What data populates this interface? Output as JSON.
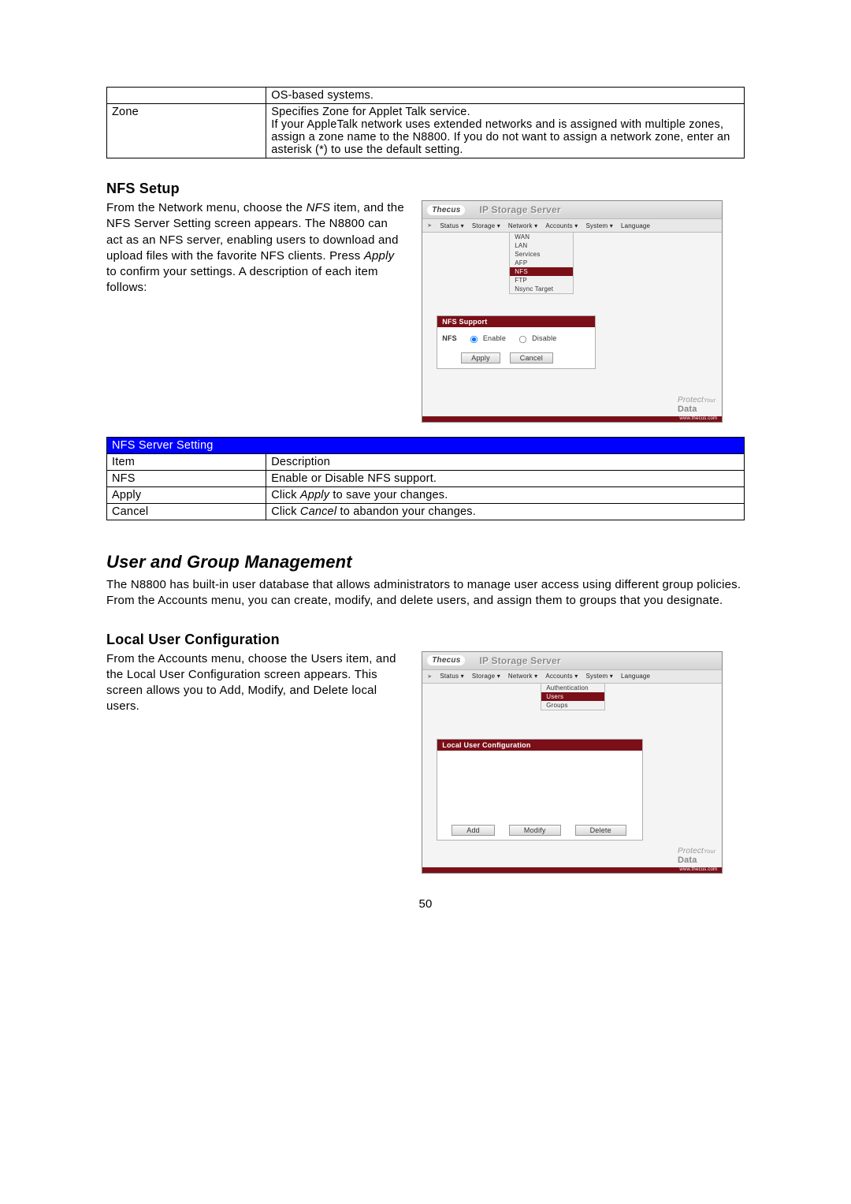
{
  "table1": {
    "r0c1": "OS-based systems.",
    "r1c0": "Zone",
    "r1c1": "Specifies Zone for Applet Talk service.\nIf your AppleTalk network uses extended networks and is assigned with multiple zones, assign a zone name to the N8800. If you do not want to assign a network zone, enter an asterisk (*) to use the default setting."
  },
  "nfs_heading": "NFS Setup",
  "nfs_para_parts": {
    "a": "From the Network menu, choose the ",
    "b": "NFS",
    "c": " item, and the NFS Server Setting screen appears. The N8800 can act as an NFS server, enabling users to download and upload files with the favorite NFS clients. Press ",
    "d": "Apply",
    "e": " to confirm your settings. A description of each item follows:"
  },
  "shot1": {
    "logo": "Thecus",
    "title": "IP Storage Server",
    "menu": [
      "Status ▾",
      "Storage ▾",
      "Network ▾",
      "Accounts ▾",
      "System ▾",
      "Language"
    ],
    "submenu": [
      "WAN",
      "LAN",
      "Services",
      "AFP",
      "NFS",
      "FTP",
      "Nsync Target"
    ],
    "submenu_selected": "NFS",
    "panel_title": "NFS Support",
    "row_label": "NFS",
    "opt_enable": "Enable",
    "opt_disable": "Disable",
    "btn_apply": "Apply",
    "btn_cancel": "Cancel",
    "protect_a": "Protect",
    "protect_b": "Your",
    "protect_c": "Data",
    "url": "www.thecus.com"
  },
  "table2": {
    "header": "NFS Server Setting",
    "r0c0": "Item",
    "r0c1": "Description",
    "r1c0": "NFS",
    "r1c1": "Enable or Disable NFS support.",
    "r2c0": "Apply",
    "r2c1a": "Click ",
    "r2c1b": "Apply",
    "r2c1c": " to save your changes.",
    "r3c0": "Cancel",
    "r3c1a": "Click ",
    "r3c1b": "Cancel",
    "r3c1c": " to abandon your changes."
  },
  "ugm_heading": "User and Group Management",
  "ugm_para": "The N8800 has built-in user database that allows administrators to manage user access using different group policies. From the Accounts menu, you can create, modify, and delete users, and assign them to groups that you designate.",
  "luc_heading": "Local User Configuration",
  "luc_para_parts": {
    "a": "From the Accounts menu, choose the Users item, and the Local User Configuration screen appears. This screen allows you to Add, Modify, and Delete local users."
  },
  "shot2": {
    "logo": "Thecus",
    "title": "IP Storage Server",
    "menu": [
      "Status ▾",
      "Storage ▾",
      "Network ▾",
      "Accounts ▾",
      "System ▾",
      "Language"
    ],
    "submenu": [
      "Authentication",
      "Users",
      "Groups"
    ],
    "submenu_selected": "Users",
    "panel_title": "Local User Configuration",
    "btn_add": "Add",
    "btn_modify": "Modify",
    "btn_delete": "Delete",
    "protect_a": "Protect",
    "protect_b": "Your",
    "protect_c": "Data",
    "url": "www.thecus.com"
  },
  "page_no": "50"
}
